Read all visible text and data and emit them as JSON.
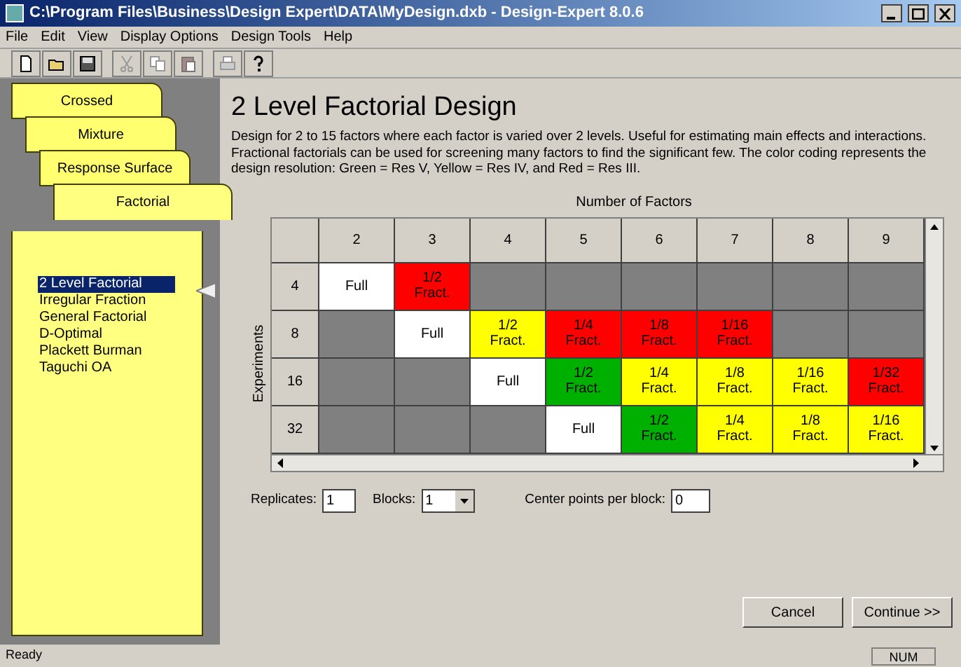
{
  "window": {
    "title": "C:\\Program Files\\Business\\Design Expert\\DATA\\MyDesign.dxb - Design-Expert 8.0.6"
  },
  "menu": [
    "File",
    "Edit",
    "View",
    "Display Options",
    "Design Tools",
    "Help"
  ],
  "tabs": [
    {
      "label": "Crossed",
      "selected": false
    },
    {
      "label": "Mixture",
      "selected": false
    },
    {
      "label": "Response Surface",
      "selected": false
    },
    {
      "label": "Factorial",
      "selected": true
    }
  ],
  "design_list": [
    {
      "label": "2 Level Factorial",
      "selected": true
    },
    {
      "label": "Irregular Fraction",
      "selected": false
    },
    {
      "label": "General Factorial",
      "selected": false
    },
    {
      "label": "D-Optimal",
      "selected": false
    },
    {
      "label": "Plackett Burman",
      "selected": false
    },
    {
      "label": "Taguchi OA",
      "selected": false
    }
  ],
  "heading": "2 Level Factorial Design",
  "description": "Design for 2 to 15 factors where each factor is varied over 2 levels.  Useful for estimating main effects and interactions.  Fractional factorials can be used for screening many factors to find the significant few. The color coding represents the design resolution: Green = Res V, Yellow = Res IV, and Red = Res III.",
  "grid": {
    "column_title": "Number of Factors",
    "row_title": "Experiments",
    "columns": [
      "2",
      "3",
      "4",
      "5",
      "6",
      "7",
      "8",
      "9"
    ],
    "rows": [
      {
        "label": "4",
        "cells": [
          {
            "lines": [
              "Full"
            ],
            "color": "#ffffff"
          },
          {
            "lines": [
              "1/2",
              "Fract."
            ],
            "color": "#ff0000"
          },
          {
            "color": "#808080"
          },
          {
            "color": "#808080"
          },
          {
            "color": "#808080"
          },
          {
            "color": "#808080"
          },
          {
            "color": "#808080"
          },
          {
            "color": "#808080"
          }
        ]
      },
      {
        "label": "8",
        "cells": [
          {
            "color": "#808080"
          },
          {
            "lines": [
              "Full"
            ],
            "color": "#ffffff"
          },
          {
            "lines": [
              "1/2",
              "Fract."
            ],
            "color": "#ffff00"
          },
          {
            "lines": [
              "1/4",
              "Fract."
            ],
            "color": "#ff0000"
          },
          {
            "lines": [
              "1/8",
              "Fract."
            ],
            "color": "#ff0000"
          },
          {
            "lines": [
              "1/16",
              "Fract."
            ],
            "color": "#ff0000"
          },
          {
            "color": "#808080"
          },
          {
            "color": "#808080"
          }
        ]
      },
      {
        "label": "16",
        "cells": [
          {
            "color": "#808080"
          },
          {
            "color": "#808080"
          },
          {
            "lines": [
              "Full"
            ],
            "color": "#ffffff"
          },
          {
            "lines": [
              "1/2",
              "Fract."
            ],
            "color": "#00b000"
          },
          {
            "lines": [
              "1/4",
              "Fract."
            ],
            "color": "#ffff00"
          },
          {
            "lines": [
              "1/8",
              "Fract."
            ],
            "color": "#ffff00"
          },
          {
            "lines": [
              "1/16",
              "Fract."
            ],
            "color": "#ffff00"
          },
          {
            "lines": [
              "1/32",
              "Fract."
            ],
            "color": "#ff0000"
          }
        ]
      },
      {
        "label": "32",
        "cells": [
          {
            "color": "#808080"
          },
          {
            "color": "#808080"
          },
          {
            "color": "#808080"
          },
          {
            "lines": [
              "Full"
            ],
            "color": "#ffffff"
          },
          {
            "lines": [
              "1/2",
              "Fract."
            ],
            "color": "#00b000"
          },
          {
            "lines": [
              "1/4",
              "Fract."
            ],
            "color": "#ffff00"
          },
          {
            "lines": [
              "1/8",
              "Fract."
            ],
            "color": "#ffff00"
          },
          {
            "lines": [
              "1/16",
              "Fract."
            ],
            "color": "#ffff00"
          }
        ]
      }
    ]
  },
  "replicates": {
    "label": "Replicates:",
    "value": "1"
  },
  "blocks": {
    "label": "Blocks:",
    "value": "1"
  },
  "center_points": {
    "label": "Center points per block:",
    "value": "0"
  },
  "buttons": [
    "Cancel",
    "Continue >>"
  ],
  "status_bar": {
    "message": "Ready",
    "indicator": "NUM"
  }
}
